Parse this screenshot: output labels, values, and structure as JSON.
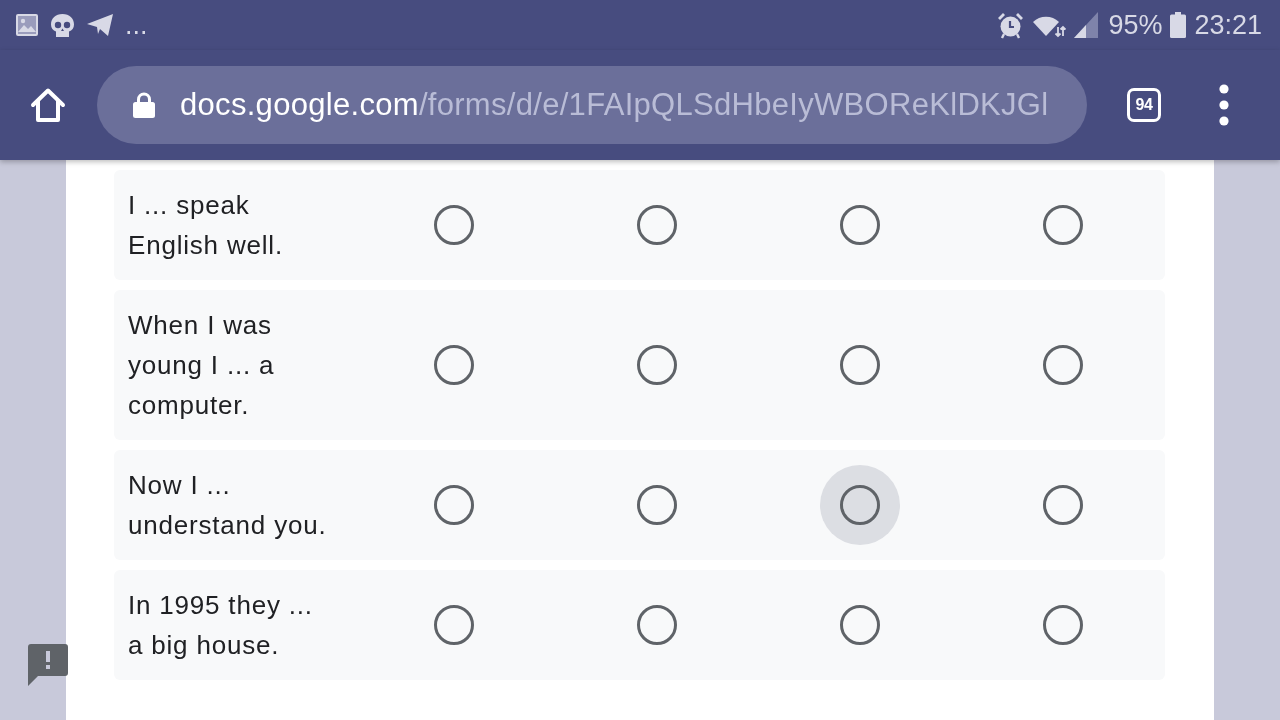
{
  "status_bar": {
    "overflow": "...",
    "battery": "95%",
    "time": "23:21"
  },
  "toolbar": {
    "url": {
      "domain": "docs.google.com",
      "path": "/forms/d/e/1FAIpQLSdHbeIyWBOReKlDKJGl"
    },
    "tab_count": "94"
  },
  "rows": [
    {
      "statement": "I ... speak English well.",
      "options": [
        {
          "selected": false,
          "focused": false
        },
        {
          "selected": false,
          "focused": false
        },
        {
          "selected": false,
          "focused": false
        },
        {
          "selected": false,
          "focused": false
        }
      ]
    },
    {
      "statement": "When I was young I ... a computer.",
      "options": [
        {
          "selected": false,
          "focused": false
        },
        {
          "selected": false,
          "focused": false
        },
        {
          "selected": false,
          "focused": false
        },
        {
          "selected": false,
          "focused": false
        }
      ]
    },
    {
      "statement": "Now I ... understand you.",
      "options": [
        {
          "selected": false,
          "focused": false
        },
        {
          "selected": false,
          "focused": false
        },
        {
          "selected": false,
          "focused": true
        },
        {
          "selected": false,
          "focused": false
        }
      ]
    },
    {
      "statement": "In 1995 they ... a big house.",
      "options": [
        {
          "selected": false,
          "focused": false
        },
        {
          "selected": false,
          "focused": false
        },
        {
          "selected": false,
          "focused": false
        },
        {
          "selected": false,
          "focused": false
        }
      ]
    }
  ]
}
